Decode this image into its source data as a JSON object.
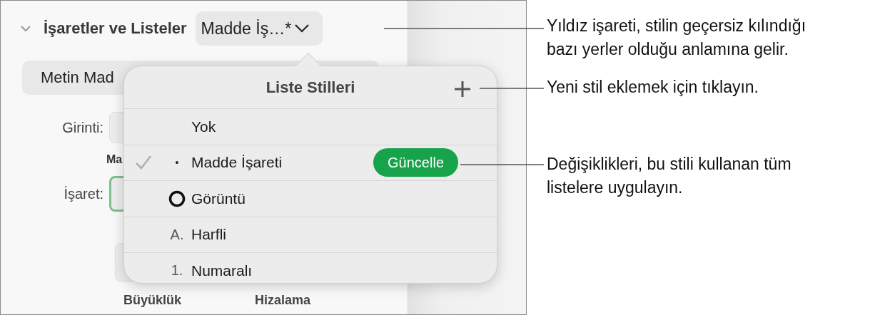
{
  "panel": {
    "section_title": "İşaretler ve Listeler",
    "section_expanded": true,
    "style_menu": "Madde İş…*",
    "text_button": "Metin Mad",
    "indent_label": "Girinti:",
    "column_label": "Ma",
    "bullet_label": "İşaret:",
    "size_label": "Büyüklük",
    "align_label": "Hizalama"
  },
  "popover": {
    "title": "Liste Stilleri",
    "items": [
      {
        "kind": "none",
        "label": "Yok",
        "selected": false
      },
      {
        "kind": "bullet",
        "marker": "•",
        "label": "Madde İşareti",
        "selected": true,
        "update_button": "Güncelle"
      },
      {
        "kind": "image",
        "label": "Görüntü",
        "selected": false
      },
      {
        "kind": "letter",
        "marker": "A.",
        "label": "Harfli",
        "selected": false
      },
      {
        "kind": "number",
        "marker": "1.",
        "label": "Numaralı",
        "selected": false
      }
    ]
  },
  "callouts": [
    {
      "text": "Yıldız işareti, stilin geçersiz kılındığı bazı yerler olduğu anlamına gelir."
    },
    {
      "text": "Yeni stil eklemek için tıklayın."
    },
    {
      "text": "Değişiklikleri, bu stili kullanan tüm listelere uygulayın."
    }
  ]
}
